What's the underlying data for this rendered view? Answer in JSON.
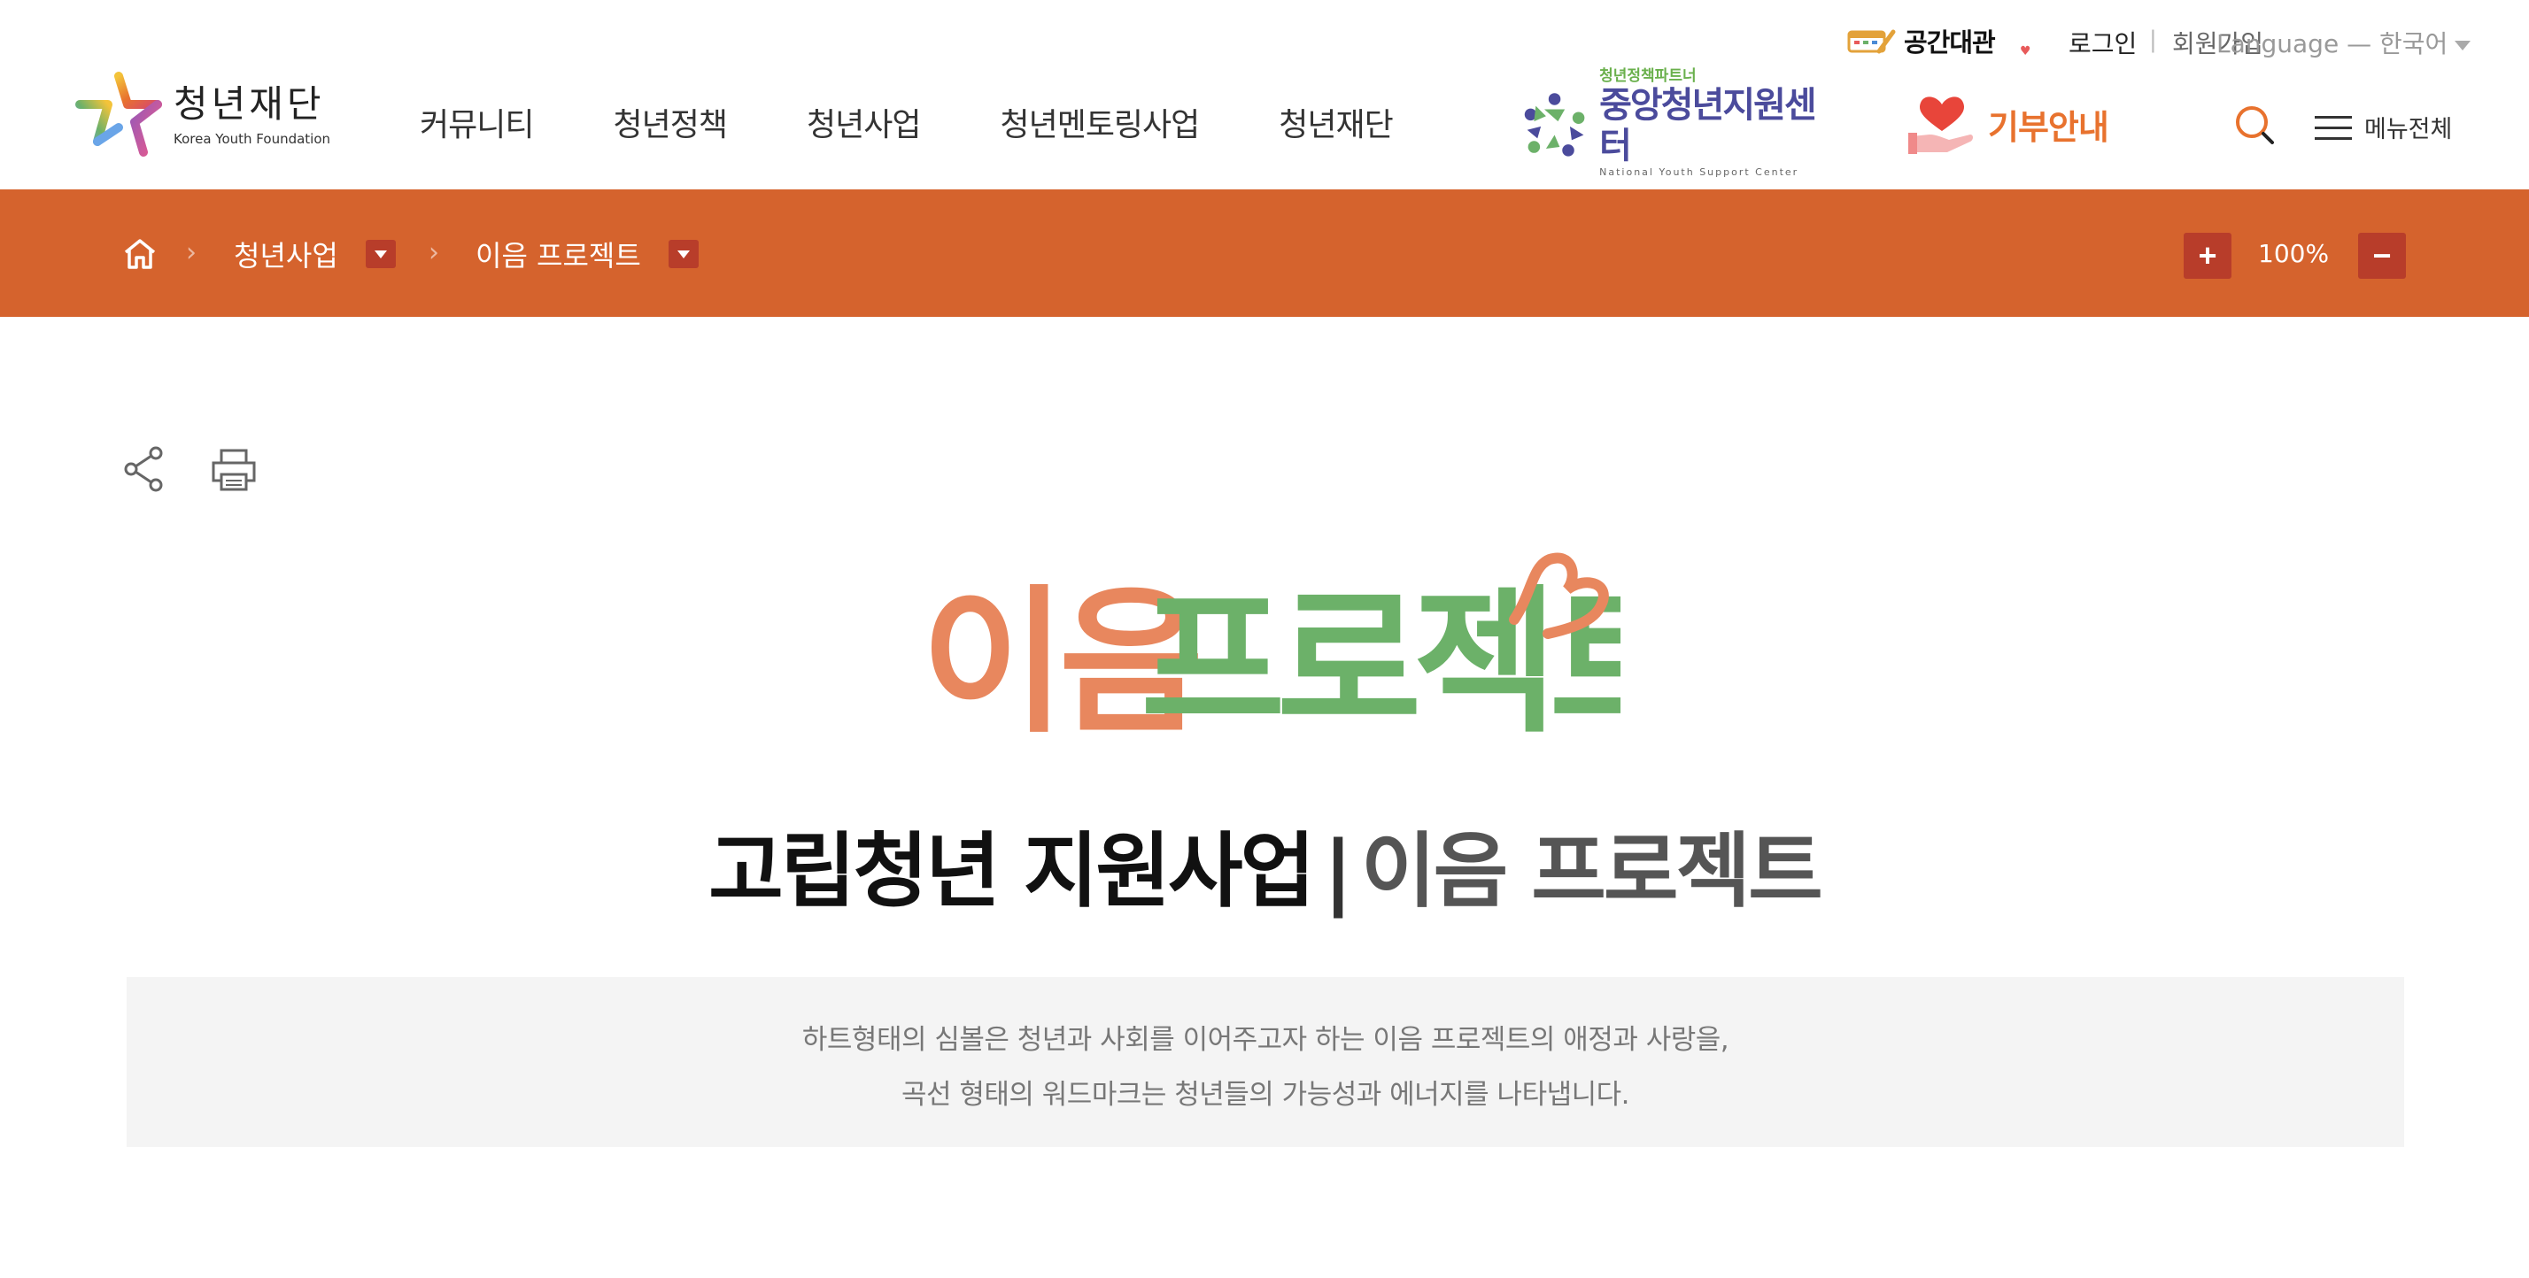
{
  "utility": {
    "space_rental": "공간대관",
    "login": "로그인",
    "divider": "|",
    "signup": "회원가입",
    "language": "Language — 한국어"
  },
  "logo": {
    "name_ko": "청년재단",
    "name_en": "Korea Youth Foundation"
  },
  "gnb": {
    "items": [
      "커뮤니티",
      "청년정책",
      "청년사업",
      "청년멘토링사업",
      "청년재단"
    ]
  },
  "partner": {
    "tagline": "청년정책파트너",
    "name": "중앙청년지원센터",
    "name_en": "National Youth Support Center"
  },
  "donate": {
    "label": "기부안내"
  },
  "menu": {
    "label": "메뉴전체"
  },
  "breadcrumb": {
    "level1": "청년사업",
    "level2": "이음 프로젝트"
  },
  "zoom": {
    "plus": "+",
    "value": "100%",
    "minus": "−"
  },
  "hero": {
    "word1": "이음",
    "word2": "프로젝트"
  },
  "title": {
    "strong": "고립청년 지원사업",
    "pipe": "|",
    "light": "이음 프로젝트"
  },
  "description": {
    "line1": "하트형태의 심볼은 청년과 사회를 이어주고자 하는 이음 프로젝트의 애정과 사랑을,",
    "line2": "곡선 형태의 워드마크는 청년들의 가능성과 에너지를 나타냅니다."
  },
  "colors": {
    "brand_orange": "#d5632d",
    "dropdown_red": "#b83d2a",
    "hero_orange": "#e8875e",
    "hero_green": "#6cb169",
    "partner_purple": "#4b4b9c"
  },
  "icons": [
    "home-icon",
    "share-icon",
    "print-icon",
    "search-icon",
    "hamburger-icon",
    "heart-hand-icon"
  ]
}
